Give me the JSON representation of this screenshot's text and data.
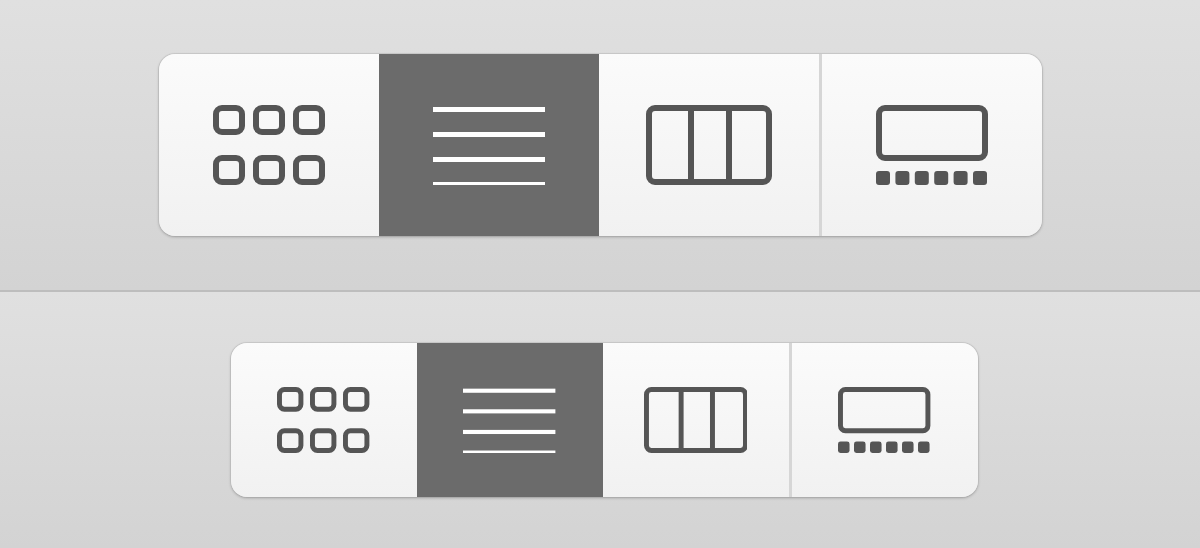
{
  "controls": [
    {
      "segments": [
        {
          "kind": "icons",
          "selected": false
        },
        {
          "kind": "list",
          "selected": true
        },
        {
          "kind": "columns",
          "selected": false
        },
        {
          "kind": "gallery",
          "selected": false
        }
      ]
    },
    {
      "segments": [
        {
          "kind": "icons",
          "selected": false
        },
        {
          "kind": "list",
          "selected": true
        },
        {
          "kind": "columns",
          "selected": false
        },
        {
          "kind": "gallery",
          "selected": false
        }
      ]
    }
  ]
}
